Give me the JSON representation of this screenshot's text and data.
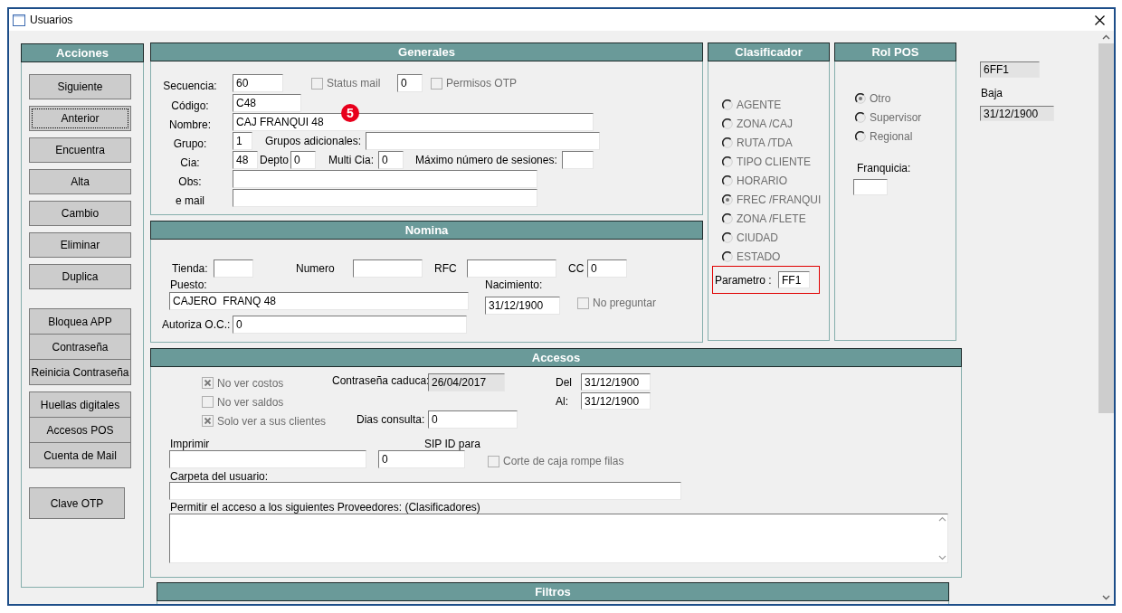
{
  "window": {
    "title": "Usuarios"
  },
  "acciones": {
    "title": "Acciones",
    "groups": [
      [
        {
          "label": "Siguiente",
          "focused": false
        },
        {
          "label": "Anterior",
          "focused": true
        },
        {
          "label": "Encuentra",
          "focused": false
        },
        {
          "label": "Alta",
          "focused": false
        },
        {
          "label": "Cambio",
          "focused": false
        },
        {
          "label": "Eliminar",
          "focused": false
        },
        {
          "label": "Duplica",
          "focused": false
        }
      ],
      [
        {
          "label": "Bloquea APP",
          "focused": false
        },
        {
          "label": "Contraseña",
          "focused": false
        },
        {
          "label": "Reinicia Contraseña",
          "focused": false
        }
      ],
      [
        {
          "label": "Huellas digitales",
          "focused": false
        },
        {
          "label": "Accesos POS",
          "focused": false
        },
        {
          "label": "Cuenta de Mail",
          "focused": false
        }
      ],
      [
        {
          "label": "Clave OTP",
          "focused": false
        }
      ]
    ]
  },
  "generales": {
    "title": "Generales",
    "badge": "5",
    "secuencia": {
      "label": "Secuencia:",
      "value": "60"
    },
    "status_mail": {
      "label": "Status mail",
      "checked": false,
      "disabled": true
    },
    "status_count": {
      "value": "0"
    },
    "permisos_otp": {
      "label": "Permisos OTP",
      "checked": false,
      "disabled": true
    },
    "codigo": {
      "label": "Código:",
      "value": "C48"
    },
    "nombre": {
      "label": "Nombre:",
      "value": "CAJ FRANQUI 48"
    },
    "grupo": {
      "label": "Grupo:",
      "value": "1"
    },
    "grupos_adicionales": {
      "label": "Grupos adicionales:"
    },
    "cia": {
      "label": "Cia:",
      "value": "48"
    },
    "depto": {
      "label": "Depto",
      "value": "0"
    },
    "multi_cia": {
      "label": "Multi Cia:",
      "value": "0"
    },
    "max_sesiones": {
      "label": "Máximo número de sesiones:"
    },
    "obs": {
      "label": "Obs:"
    },
    "email": {
      "label": "e mail"
    }
  },
  "nomina": {
    "title": "Nomina",
    "tienda": {
      "label": "Tienda:"
    },
    "numero": {
      "label": "Numero"
    },
    "rfc": {
      "label": "RFC"
    },
    "cc": {
      "label": "CC",
      "value": "0"
    },
    "puesto": {
      "label": "Puesto:",
      "value": "CAJERO  FRANQ 48"
    },
    "nacimiento": {
      "label": "Nacimiento:",
      "value": "31/12/1900"
    },
    "no_preguntar": {
      "label": "No preguntar",
      "checked": false,
      "disabled": true
    },
    "autoriza": {
      "label": "Autoriza O.C.:",
      "value": "0"
    }
  },
  "clasificador": {
    "title": "Clasificador",
    "options": [
      {
        "label": "AGENTE",
        "selected": false,
        "disabled": true
      },
      {
        "label": "ZONA /CAJ",
        "selected": false,
        "disabled": true
      },
      {
        "label": "RUTA /TDA",
        "selected": false,
        "disabled": true
      },
      {
        "label": "TIPO CLIENTE",
        "selected": false,
        "disabled": true
      },
      {
        "label": "HORARIO",
        "selected": false,
        "disabled": true
      },
      {
        "label": "FREC /FRANQUI",
        "selected": true,
        "disabled": true
      },
      {
        "label": "ZONA /FLETE",
        "selected": false,
        "disabled": true
      },
      {
        "label": "CIUDAD",
        "selected": false,
        "disabled": true
      },
      {
        "label": "ESTADO",
        "selected": false,
        "disabled": true
      }
    ],
    "parametro": {
      "label": "Parametro :",
      "value": "FF1"
    }
  },
  "rol_pos": {
    "title": "Rol POS",
    "options": [
      {
        "label": "Otro",
        "selected": true,
        "disabled": true
      },
      {
        "label": "Supervisor",
        "selected": false,
        "disabled": true
      },
      {
        "label": "Regional",
        "selected": false,
        "disabled": true
      }
    ],
    "franquicia": {
      "label": "Franquicia:"
    }
  },
  "side": {
    "code": {
      "value": "6FF1",
      "readonly": true
    },
    "baja": {
      "label": "Baja",
      "value": "31/12/1900",
      "readonly": true
    }
  },
  "accesos": {
    "title": "Accesos",
    "no_ver_costos": {
      "label": "No ver costos",
      "checked": true,
      "disabled": true
    },
    "no_ver_saldos": {
      "label": "No ver saldos",
      "checked": false,
      "disabled": true
    },
    "solo_ver": {
      "label": "Solo ver a sus clientes",
      "checked": true,
      "disabled": true
    },
    "contrasena_caduca": {
      "label": "Contraseña caduca:",
      "value": "26/04/2017",
      "readonly": true
    },
    "dias_consulta": {
      "label": "Dias consulta:",
      "value": "0"
    },
    "del": {
      "label": "Del",
      "value": "31/12/1900"
    },
    "al": {
      "label": "Al:",
      "value": "31/12/1900"
    },
    "imprimir": {
      "label": "Imprimir"
    },
    "sip_id": {
      "label": "SIP ID para",
      "value": "0"
    },
    "corte_caja": {
      "label": "Corte de caja rompe filas",
      "checked": false,
      "disabled": true
    },
    "carpeta": {
      "label": "Carpeta del usuario:"
    },
    "proveedores": {
      "label": "Permitir el acceso a los siguientes Proveedores: (Clasificadores)"
    }
  },
  "filtros": {
    "title": "Filtros"
  }
}
